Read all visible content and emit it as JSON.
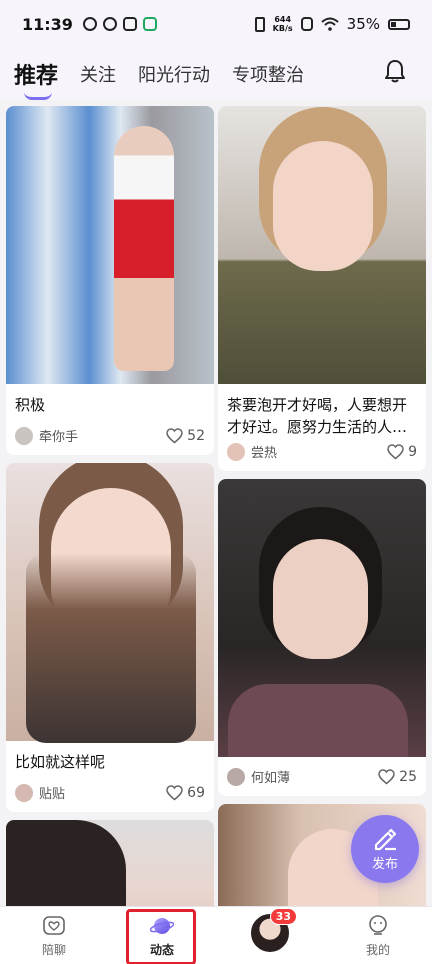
{
  "status": {
    "time": "11:39",
    "net_speed_value": "644",
    "net_speed_unit": "KB/s",
    "battery": "35%"
  },
  "nav": {
    "tabs": [
      {
        "label": "推荐"
      },
      {
        "label": "关注"
      },
      {
        "label": "阳光行动"
      },
      {
        "label": "专项整治"
      }
    ]
  },
  "feed": {
    "left": [
      {
        "title": "积极",
        "author": "牵你手",
        "likes": "52"
      },
      {
        "title": "比如就这样呢",
        "author": "贴贴",
        "likes": "69"
      },
      {
        "title": "",
        "author": "",
        "likes": ""
      }
    ],
    "right": [
      {
        "title": "茶要泡开才好喝，人要想开才好过。愿努力生活的人…",
        "author": "尝热",
        "likes": "9"
      },
      {
        "title": "",
        "author": "何如薄",
        "likes": "25"
      },
      {
        "title": "",
        "author": "",
        "likes": ""
      }
    ]
  },
  "publish": {
    "label": "发布"
  },
  "bottom_bar": {
    "items": [
      {
        "label": "陪聊"
      },
      {
        "label": "动态"
      },
      {
        "label": ""
      },
      {
        "label": "我的"
      }
    ],
    "badge": "33"
  },
  "colors": {
    "accent": "#8a78ef",
    "badge": "#f23a3a",
    "highlight_frame": "#e0202c"
  }
}
